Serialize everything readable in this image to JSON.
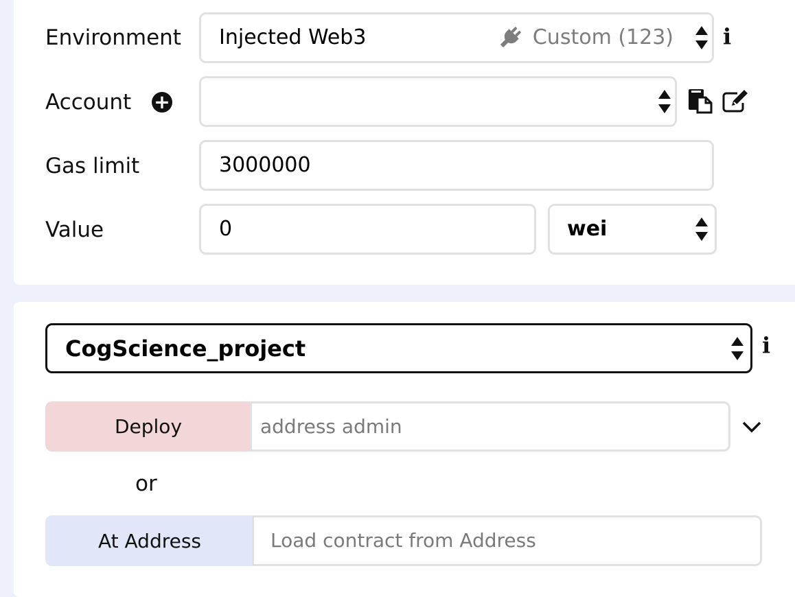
{
  "environment": {
    "label": "Environment",
    "value": "Injected Web3",
    "network": "Custom (123)",
    "network_icon": "plug-icon",
    "info_icon": "info-icon"
  },
  "account": {
    "label": "Account",
    "value": "",
    "add_icon": "plus-circle-icon",
    "copy_icon": "copy-icon",
    "edit_icon": "edit-icon"
  },
  "gas_limit": {
    "label": "Gas limit",
    "value": "3000000"
  },
  "value": {
    "label": "Value",
    "amount": "0",
    "unit": "wei"
  },
  "contract": {
    "selected": "CogScience_project",
    "info_icon": "info-icon"
  },
  "deploy": {
    "button_label": "Deploy",
    "placeholder": "address admin",
    "expand_icon": "chevron-down-icon",
    "color": "#f3d6d7"
  },
  "or_label": "or",
  "at_address": {
    "button_label": "At Address",
    "placeholder": "Load contract from Address",
    "color": "#e1e6f8"
  }
}
